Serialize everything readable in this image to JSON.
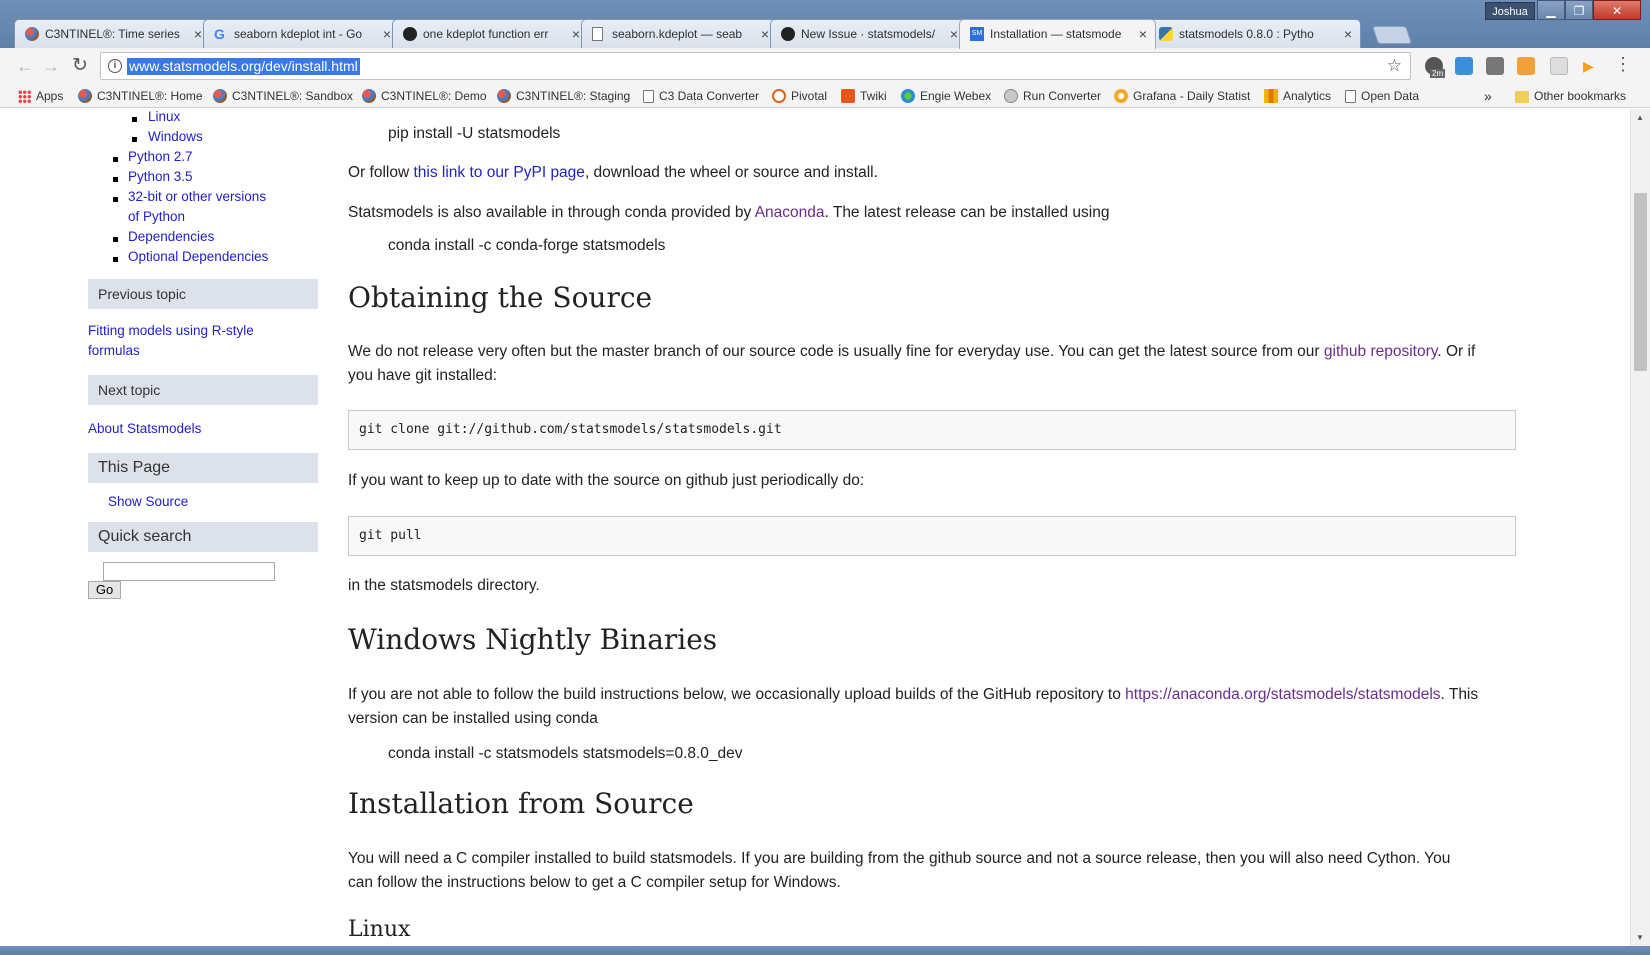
{
  "window": {
    "user": "Joshua",
    "controls": {
      "minimize": "▁",
      "maximize": "❐",
      "close": "✕"
    }
  },
  "tabs": [
    {
      "title": "C3NTINEL®: Time series",
      "icon": "c3-icon",
      "active": false
    },
    {
      "title": "seaborn kdeplot int - Go",
      "icon": "google-icon",
      "active": false
    },
    {
      "title": "one kdeplot function err",
      "icon": "github-icon",
      "active": false
    },
    {
      "title": "seaborn.kdeplot — seab",
      "icon": "page-icon",
      "active": false
    },
    {
      "title": "New Issue · statsmodels/",
      "icon": "github-icon",
      "active": false
    },
    {
      "title": "Installation — statsmode",
      "icon": "sm-icon",
      "active": true
    },
    {
      "title": "statsmodels 0.8.0 : Pytho",
      "icon": "python-icon",
      "active": false
    }
  ],
  "toolbar": {
    "back": "←",
    "forward": "→",
    "reload": "↻",
    "url": "www.statsmodels.org/dev/install.html",
    "star": "☆",
    "menu": "⋮",
    "ext_badge": "2m"
  },
  "bookmarks": [
    {
      "label": "Apps",
      "icon": "apps-icon"
    },
    {
      "label": "C3NTINEL®: Home",
      "icon": "c3-icon"
    },
    {
      "label": "C3NTINEL®: Sandbox",
      "icon": "c3-icon"
    },
    {
      "label": "C3NTINEL®: Demo",
      "icon": "c3-icon"
    },
    {
      "label": "C3NTINEL®: Staging",
      "icon": "c3-icon"
    },
    {
      "label": "C3 Data Converter",
      "icon": "page-icon"
    },
    {
      "label": "Pivotal",
      "icon": "pivotal-icon"
    },
    {
      "label": "Twiki",
      "icon": "twiki-icon"
    },
    {
      "label": "Engie Webex",
      "icon": "webex-icon"
    },
    {
      "label": "Run Converter",
      "icon": "run-icon"
    },
    {
      "label": "Grafana - Daily Statist",
      "icon": "grafana-icon"
    },
    {
      "label": "Analytics",
      "icon": "analytics-icon"
    },
    {
      "label": "Open Data",
      "icon": "page-icon"
    }
  ],
  "bookmarks_more": "»",
  "other_bookmarks": "Other bookmarks",
  "sidebar": {
    "toc_sub": [
      "Linux",
      "Windows"
    ],
    "toc": [
      "Python 2.7",
      "Python 3.5",
      "32-bit or other versions",
      "of Python",
      "Dependencies",
      "Optional Dependencies"
    ],
    "previous_topic": {
      "heading": "Previous topic",
      "link_line1": "Fitting models using R-style",
      "link_line2": "formulas"
    },
    "next_topic": {
      "heading": "Next topic",
      "link": "About Statsmodels"
    },
    "this_page": {
      "heading": "This Page",
      "link": "Show Source"
    },
    "quick_search": {
      "heading": "Quick search",
      "value": "",
      "go": "Go"
    }
  },
  "content": {
    "pip_cmd": "pip install -U statsmodels",
    "pypi_pre": "Or follow ",
    "pypi_link": "this link to our PyPI page",
    "pypi_post": ", download the wheel or source and install.",
    "conda_pre": "Statsmodels is also available in through conda provided by ",
    "conda_link": "Anaconda",
    "conda_post": ". The latest release can be installed using",
    "conda_cmd": "conda install -c conda-forge statsmodels",
    "h_source": "Obtaining the Source",
    "source_pre": "We do not release very often but the master branch of our source code is usually fine for everyday use. You can get the latest source from our ",
    "source_link": "github repository",
    "source_post": ". Or if",
    "source_line2": "you have git installed:",
    "git_clone": "git clone git://github.com/statsmodels/statsmodels.git",
    "keep_up": "If you want to keep up to date with the source on github just periodically do:",
    "git_pull": "git pull",
    "in_dir": "in the statsmodels directory.",
    "h_nightly": "Windows Nightly Binaries",
    "nightly_pre": "If you are not able to follow the build instructions below, we occasionally upload builds of the GitHub repository to ",
    "nightly_link": "https://anaconda.org/statsmodels/statsmodels",
    "nightly_post": ". This",
    "nightly_line2": "version can be installed using conda",
    "nightly_cmd": "conda install -c statsmodels statsmodels=0.8.0_dev",
    "h_install_src": "Installation from Source",
    "install_line1": "You will need a C compiler installed to build statsmodels. If you are building from the github source and not a source release, then you will also need Cython. You",
    "install_line2": "can follow the instructions below to get a C compiler setup for Windows.",
    "h_linux": "Linux"
  }
}
